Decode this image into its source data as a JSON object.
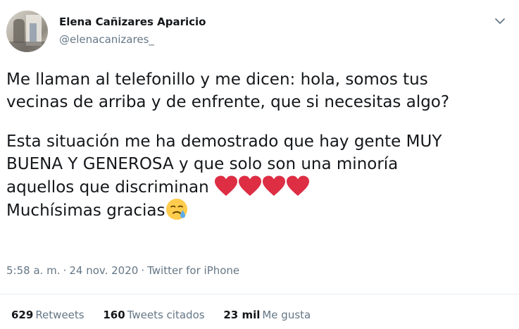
{
  "author": {
    "display_name": "Elena Cañizares Aparicio",
    "username": "@elenacanizares_"
  },
  "tweet": {
    "lines_1": [
      "Me llaman al telefonillo y me dicen: hola, somos tus",
      "vecinas de arriba y de enfrente, que si necesitas algo?"
    ],
    "lines_2": [
      "Esta situación me ha demostrado que hay gente MUY",
      "BUENA Y GENEROSA y que solo son una minoría",
      "aquellos que discriminan"
    ],
    "last_line": "Muchísimas gracias",
    "heart_count": 4,
    "heart_color": "#dd2e44",
    "emoji_icon": "face-holding-back-tears-icon"
  },
  "meta": {
    "time": "5:58 a. m.",
    "date": "24 nov. 2020",
    "source": "Twitter for iPhone",
    "separator": "·"
  },
  "stats": {
    "retweets_count": "629",
    "retweets_label": "Retweets",
    "quotes_count": "160",
    "quotes_label": "Tweets citados",
    "likes_count": "23 mil",
    "likes_label": "Me gusta"
  },
  "colors": {
    "text_primary": "#14171a",
    "text_secondary": "#657786",
    "divider": "#e6ecf0"
  }
}
